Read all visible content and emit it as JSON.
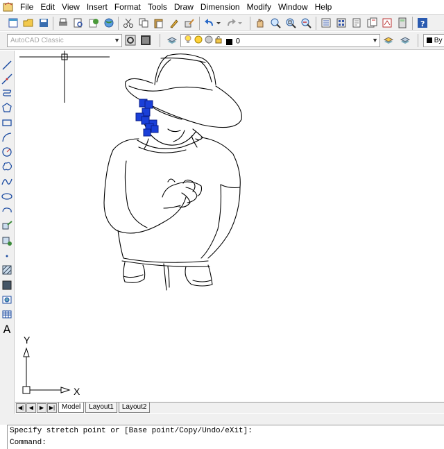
{
  "menu": {
    "items": [
      "File",
      "Edit",
      "View",
      "Insert",
      "Format",
      "Tools",
      "Draw",
      "Dimension",
      "Modify",
      "Window",
      "Help"
    ]
  },
  "toolbar": {
    "workspace_value": "AutoCAD Classic",
    "layer_value": "0",
    "color_value": "By"
  },
  "draw_toolbar": {
    "text_tool_glyph": "A"
  },
  "ucs": {
    "x_label": "X",
    "y_label": "Y"
  },
  "tabs": {
    "items": [
      "Model",
      "Layout1",
      "Layout2"
    ],
    "active": "Model"
  },
  "command": {
    "history_line": "Specify stretch point or [Base point/Copy/Undo/eXit]:",
    "prompt": "Command:"
  },
  "colors": {
    "grip_blue": "#1a3fd8",
    "toolbar_bg": "#f0f0f0"
  }
}
